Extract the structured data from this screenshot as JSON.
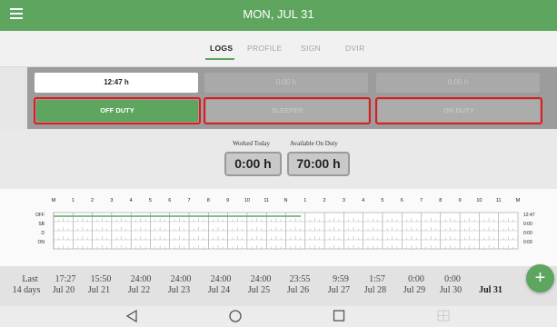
{
  "header": {
    "title": "MON, JUL 31"
  },
  "tabs": [
    {
      "label": "LOGS",
      "active": true
    },
    {
      "label": "PROFILE",
      "active": false
    },
    {
      "label": "SIGN",
      "active": false
    },
    {
      "label": "DVIR",
      "active": false
    }
  ],
  "status": {
    "hours": [
      "12:47 h",
      "0:00 h",
      "0:00 h"
    ],
    "buttons": [
      "OFF DUTY",
      "SLEEPER",
      "ON DUTY"
    ]
  },
  "summary": {
    "worked_label": "Worked Today",
    "worked_value": "0:00 h",
    "available_label": "Available On Duty",
    "available_value": "70:00 h"
  },
  "grid": {
    "hour_labels": [
      "M",
      "1",
      "2",
      "3",
      "4",
      "5",
      "6",
      "7",
      "8",
      "9",
      "10",
      "11",
      "N",
      "1",
      "2",
      "3",
      "4",
      "5",
      "6",
      "7",
      "8",
      "9",
      "10",
      "11",
      "M"
    ],
    "rows": [
      "OFF",
      "SB",
      "D",
      "ON"
    ],
    "totals": [
      "12:47",
      "0:00",
      "0:00",
      "0:00"
    ],
    "off_duty_hours": 12.78
  },
  "stats": {
    "top": [
      "Last",
      "17:27",
      "15:50",
      "24:00",
      "24:00",
      "24:00",
      "24:00",
      "23:55",
      "9:59",
      "1:57",
      "0:00",
      "0:00"
    ],
    "bottom": [
      "14 days",
      "Jul 20",
      "Jul 21",
      "Jul 22",
      "Jul 23",
      "Jul 24",
      "Jul 25",
      "Jul 26",
      "Jul 27",
      "Jul 28",
      "Jul 29",
      "Jul 30",
      "Jul 31"
    ]
  },
  "colors": {
    "accent": "#5ea55f",
    "highlight": "#e01b1b"
  },
  "icons": {
    "menu": "menu-icon",
    "add": "plus-icon",
    "back": "back-triangle-icon",
    "home": "home-circle-icon",
    "recents": "recents-square-icon"
  }
}
